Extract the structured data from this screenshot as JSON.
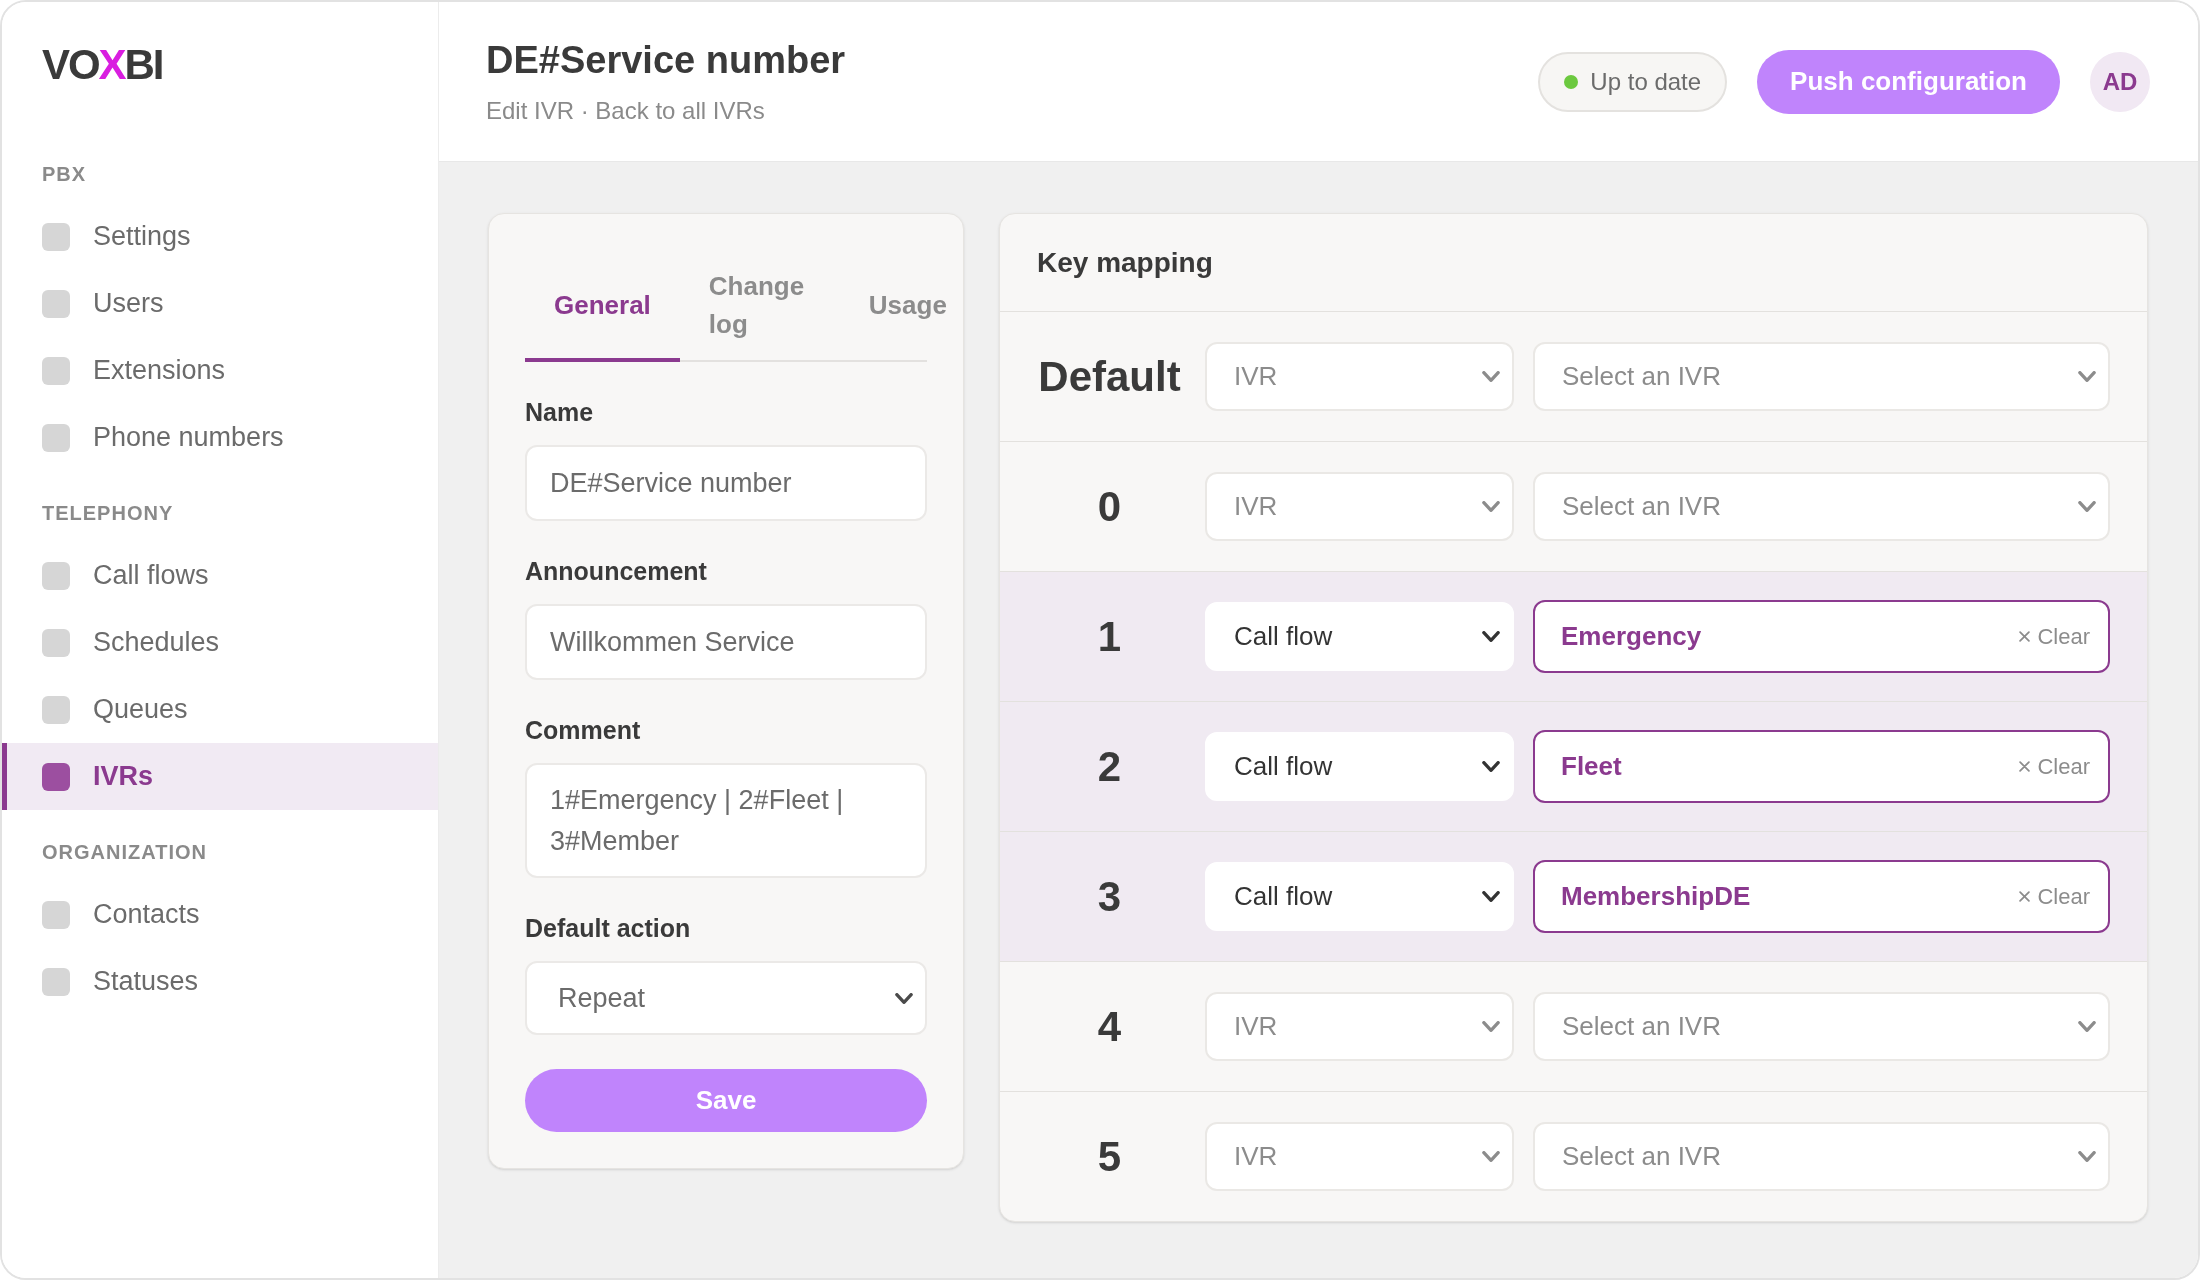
{
  "sidebar": {
    "logo": [
      {
        "text": "VO",
        "accent": false
      },
      {
        "text": "X",
        "accent": true
      },
      {
        "text": "BI",
        "accent": false
      }
    ],
    "sections": [
      {
        "title": "PBX",
        "items": [
          {
            "label": "Settings",
            "selected": false
          },
          {
            "label": "Users",
            "selected": false
          },
          {
            "label": "Extensions",
            "selected": false
          },
          {
            "label": "Phone numbers",
            "selected": false
          }
        ]
      },
      {
        "title": "TELEPHONY",
        "items": [
          {
            "label": "Call flows",
            "selected": false
          },
          {
            "label": "Schedules",
            "selected": false
          },
          {
            "label": "Queues",
            "selected": false
          },
          {
            "label": "IVRs",
            "selected": true
          }
        ]
      },
      {
        "title": "ORGANIZATION",
        "items": [
          {
            "label": "Contacts",
            "selected": false
          },
          {
            "label": "Statuses",
            "selected": false
          }
        ]
      }
    ]
  },
  "header": {
    "title": "DE#Service number",
    "subtitle": "Edit IVR · Back to all IVRs",
    "status": "Up to date",
    "push_button": "Push configuration",
    "avatar": "AD"
  },
  "editor": {
    "tabs": [
      {
        "label": "General",
        "selected": true
      },
      {
        "label": "Change log",
        "selected": false
      },
      {
        "label": "Usage",
        "selected": false
      }
    ],
    "fields": [
      {
        "kind": "input",
        "label": "Name",
        "value": "DE#Service number"
      },
      {
        "kind": "input",
        "label": "Announcement",
        "value": "Willkommen Service"
      },
      {
        "kind": "textarea",
        "label": "Comment",
        "value": "1#Emergency | 2#Fleet | 3#Member"
      },
      {
        "kind": "select",
        "label": "Default action",
        "value": "Repeat"
      }
    ],
    "save_button": "Save"
  },
  "key_mapping": {
    "title": "Key mapping",
    "rows": [
      {
        "key": "Default",
        "kind": "unassigned",
        "action": "IVR",
        "placeholder": "Select an IVR"
      },
      {
        "key": "0",
        "kind": "unassigned",
        "action": "IVR",
        "placeholder": "Select an IVR"
      },
      {
        "key": "1",
        "kind": "assigned",
        "action": "Call flow",
        "target": "Emergency",
        "clear": "Clear"
      },
      {
        "key": "2",
        "kind": "assigned",
        "action": "Call flow",
        "target": "Fleet",
        "clear": "Clear"
      },
      {
        "key": "3",
        "kind": "assigned",
        "action": "Call flow",
        "target": "MembershipDE",
        "clear": "Clear"
      },
      {
        "key": "4",
        "kind": "unassigned",
        "action": "IVR",
        "placeholder": "Select an IVR"
      },
      {
        "key": "5",
        "kind": "unassigned",
        "action": "IVR",
        "placeholder": "Select an IVR"
      }
    ]
  }
}
